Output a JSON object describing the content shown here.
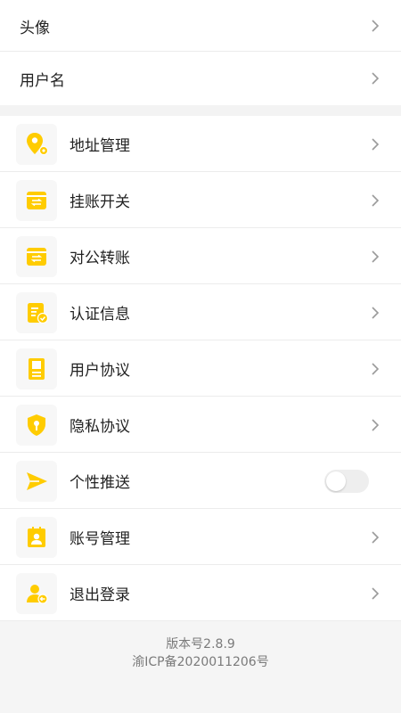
{
  "colors": {
    "accent": "#FFCC00",
    "text": "#222222",
    "muted": "#7a7a7a"
  },
  "profile": {
    "items": [
      {
        "label": "头像"
      },
      {
        "label": "用户名"
      }
    ]
  },
  "settings": {
    "items": [
      {
        "label": "地址管理",
        "icon": "location-gear-icon"
      },
      {
        "label": "挂账开关",
        "icon": "ledger-switch-icon"
      },
      {
        "label": "对公转账",
        "icon": "transfer-icon"
      },
      {
        "label": "认证信息",
        "icon": "certificate-icon"
      },
      {
        "label": "用户协议",
        "icon": "agreement-icon"
      },
      {
        "label": "隐私协议",
        "icon": "shield-icon"
      },
      {
        "label": "个性推送",
        "icon": "send-icon",
        "toggle": false
      },
      {
        "label": "账号管理",
        "icon": "account-card-icon"
      },
      {
        "label": "退出登录",
        "icon": "logout-user-icon"
      }
    ]
  },
  "footer": {
    "version": "版本号2.8.9",
    "icp": "渝ICP备2020011206号"
  }
}
